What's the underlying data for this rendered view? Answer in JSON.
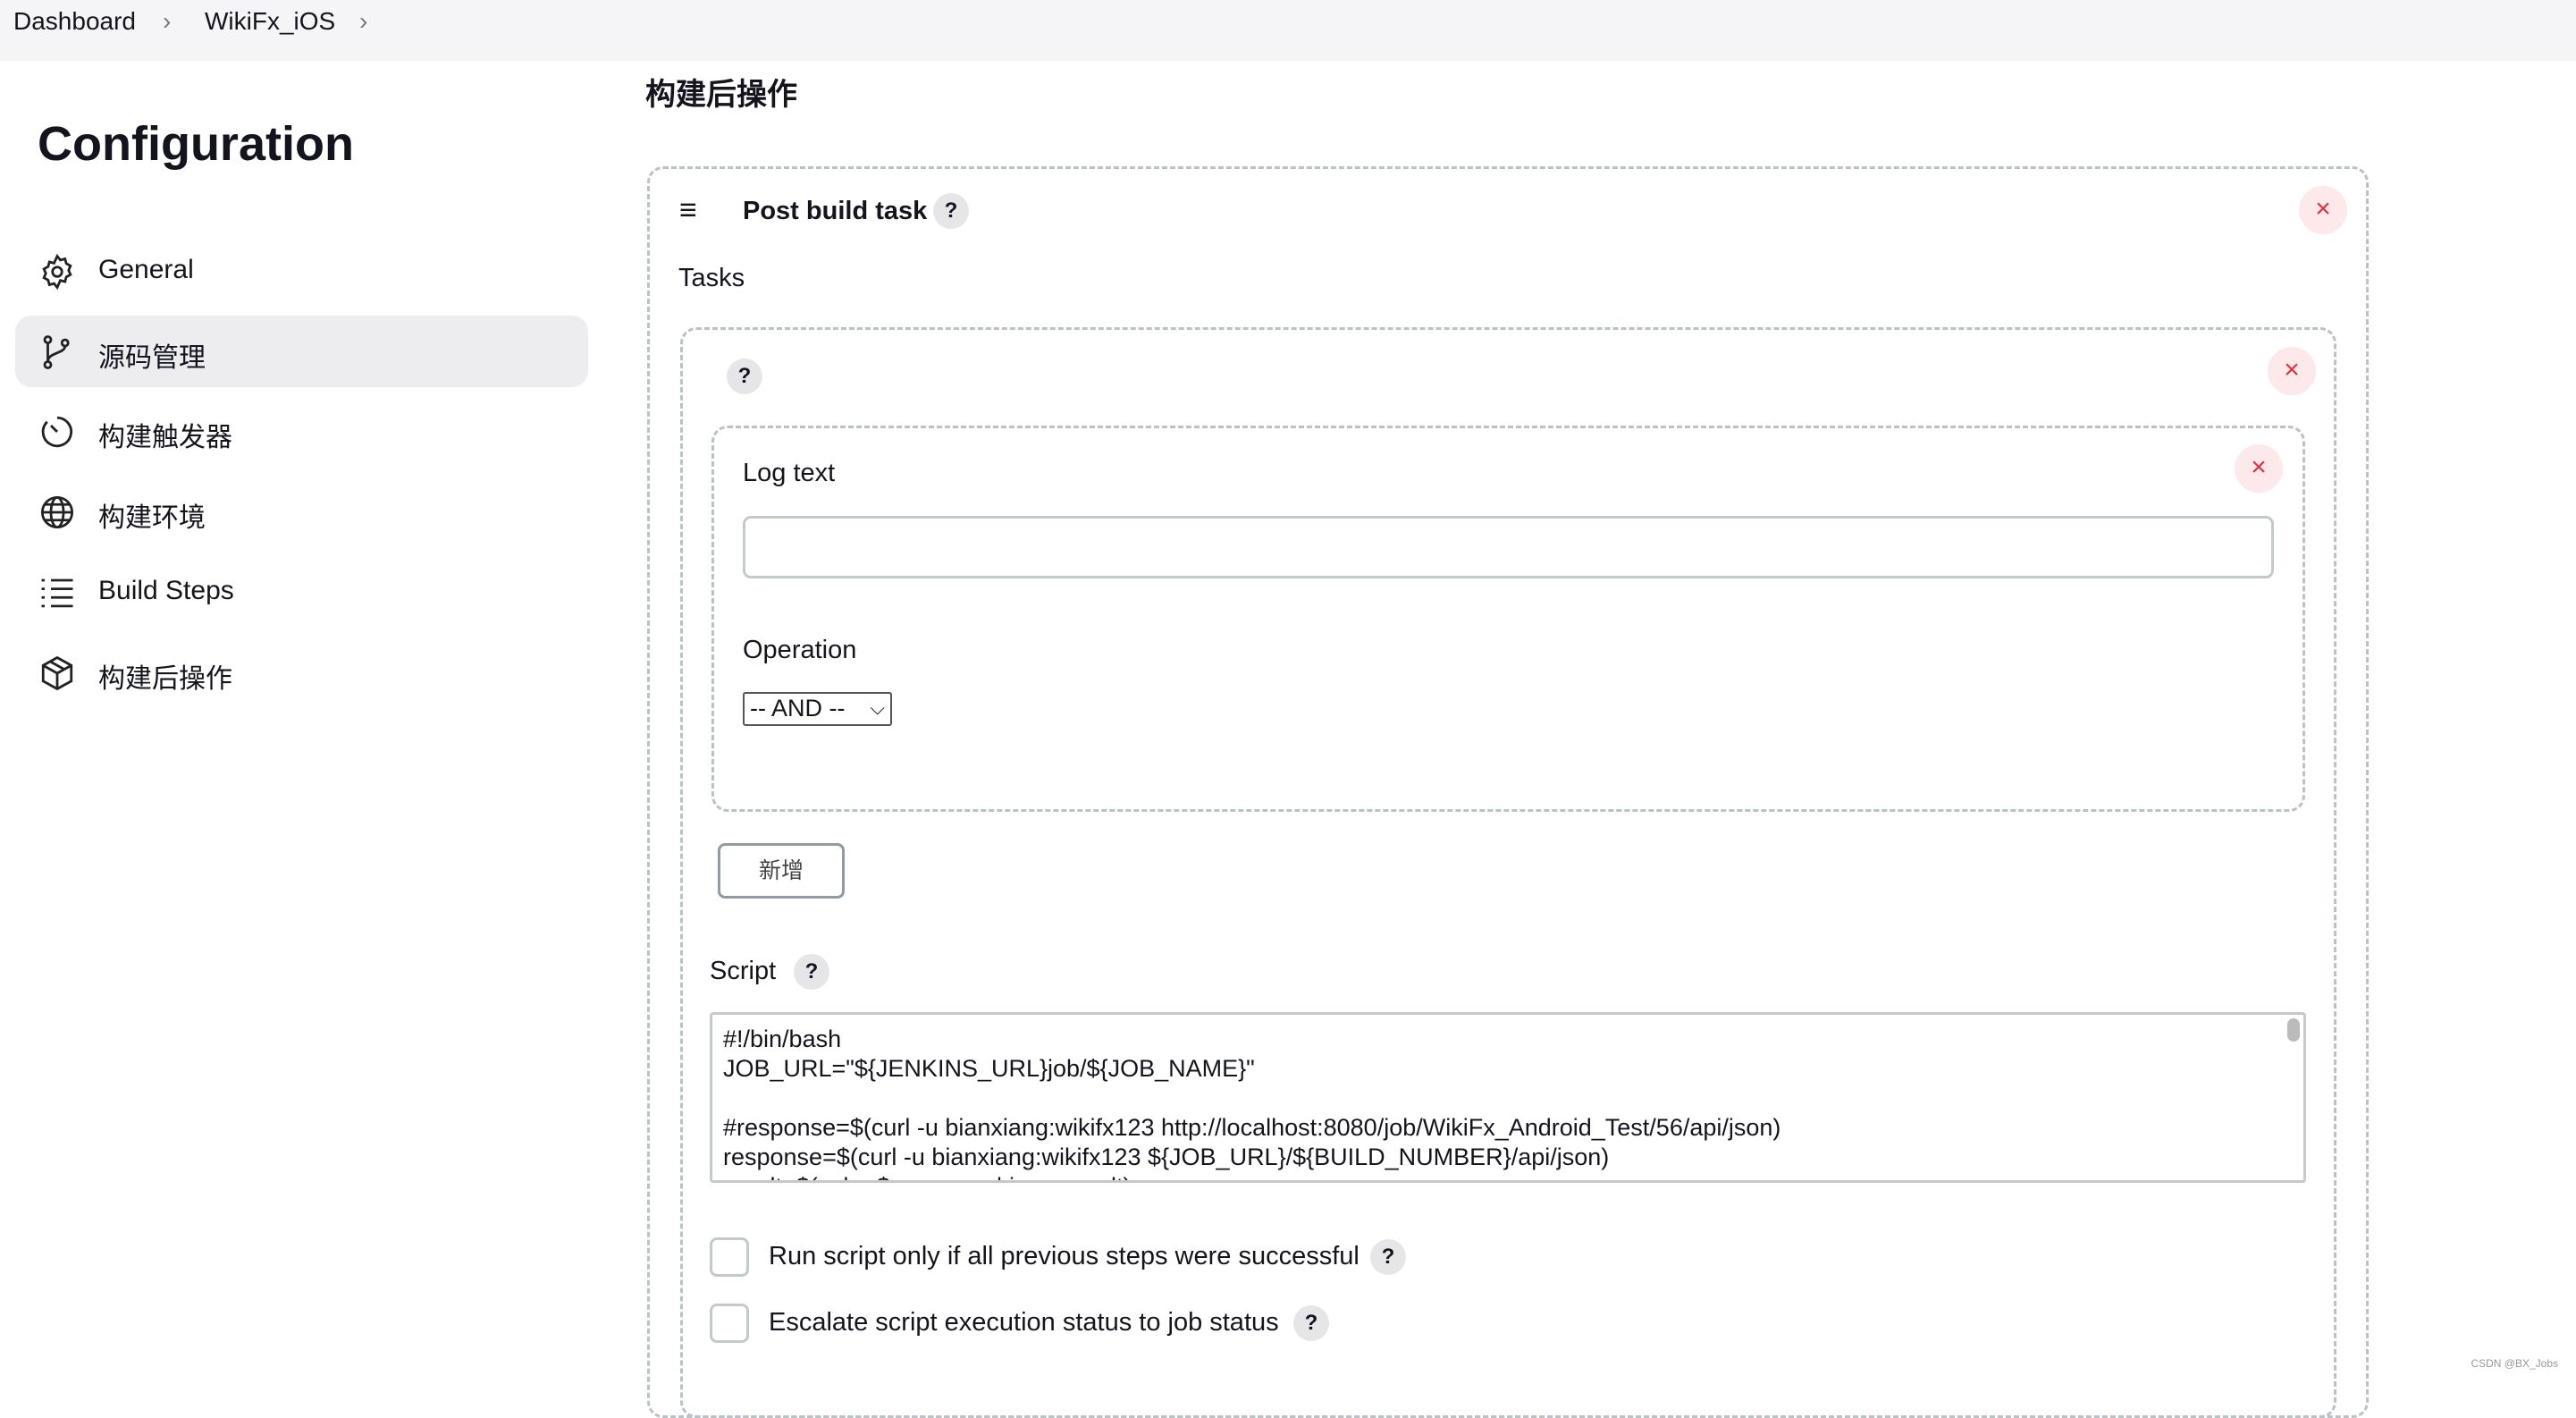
{
  "breadcrumb": {
    "items": [
      "Dashboard",
      "WikiFx_iOS"
    ]
  },
  "sidebar": {
    "title": "Configuration",
    "items": [
      {
        "label": "General",
        "icon": "gear-icon"
      },
      {
        "label": "源码管理",
        "icon": "git-branch-icon",
        "active": true
      },
      {
        "label": "构建触发器",
        "icon": "timer-icon"
      },
      {
        "label": "构建环境",
        "icon": "globe-icon"
      },
      {
        "label": "Build Steps",
        "icon": "list-icon"
      },
      {
        "label": "构建后操作",
        "icon": "package-icon"
      }
    ]
  },
  "main": {
    "section_title": "构建后操作",
    "post_build_task": {
      "title": "Post build task",
      "help": "?",
      "close": "×",
      "tasks_label": "Tasks",
      "task": {
        "help": "?",
        "close": "×",
        "log_text": {
          "label": "Log text",
          "value": "",
          "close": "×"
        },
        "operation": {
          "label": "Operation",
          "selected": "-- AND --"
        },
        "add_button": "新增",
        "script": {
          "label": "Script",
          "help": "?",
          "value": "#!/bin/bash\nJOB_URL=\"${JENKINS_URL}job/${JOB_NAME}\"\n\n#response=$(curl -u bianxiang:wikifx123 http://localhost:8080/job/WikiFx_Android_Test/56/api/json)\nresponse=$(curl -u bianxiang:wikifx123 ${JOB_URL}/${BUILD_NUMBER}/api/json)\nresult=$(echo $response | jq -r .result)"
        },
        "checkbox_run_only": {
          "label": "Run script only if all previous steps were successful",
          "checked": false,
          "help": "?"
        },
        "checkbox_escalate": {
          "label": "Escalate script execution status to job status",
          "checked": false,
          "help": "?"
        }
      }
    }
  },
  "watermark": "CSDN @BX_Jobs",
  "colors": {
    "close": "#e0303c",
    "active_bg": "#ededf0",
    "border": "#b8c2c8"
  }
}
